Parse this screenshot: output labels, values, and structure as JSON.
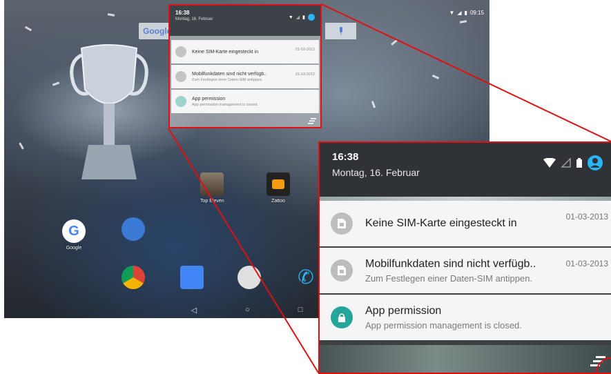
{
  "launcher": {
    "google_search": "Google",
    "status_time": "09:15",
    "apps": [
      {
        "label": "Top Eleven"
      },
      {
        "label": "Zattoo"
      },
      {
        "label": "Google"
      }
    ]
  },
  "notification_shade": {
    "time": "16:38",
    "date": "Montag, 16. Februar",
    "notifications": [
      {
        "title": "Keine SIM-Karte eingesteckt in",
        "subtitle": "",
        "time": "01-03-2013",
        "icon": "sim-card-icon"
      },
      {
        "title": "Mobilfunkdaten sind nicht verfügb..",
        "subtitle": "Zum Festlegen einer Daten-SIM antippen.",
        "time": "01-03-2013",
        "icon": "sim-card-icon"
      },
      {
        "title": "App permission",
        "subtitle": "App permission management is closed.",
        "time": "",
        "icon": "lock-icon"
      }
    ]
  },
  "colors": {
    "highlight": "#e01010",
    "accent_blue": "#29b6f6",
    "lock_green": "#26a69a"
  }
}
